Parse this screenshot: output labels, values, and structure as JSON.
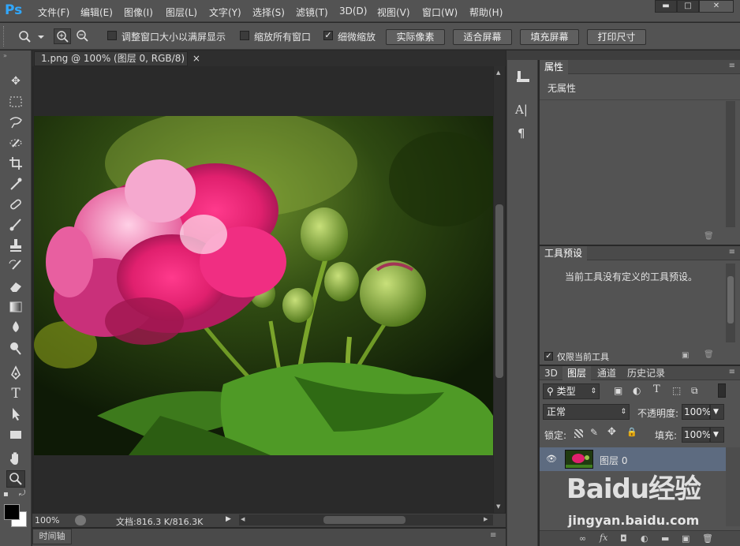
{
  "app": {
    "logo": "Ps"
  },
  "menu": [
    "文件(F)",
    "编辑(E)",
    "图像(I)",
    "图层(L)",
    "文字(Y)",
    "选择(S)",
    "滤镜(T)",
    "3D(D)",
    "视图(V)",
    "窗口(W)",
    "帮助(H)"
  ],
  "window_controls": {
    "minimize": "▬",
    "maximize": "□",
    "close": "✕"
  },
  "options": {
    "resize_windows": "调整窗口大小以满屏显示",
    "zoom_all": "缩放所有窗口",
    "scrubby_zoom": "细微缩放",
    "btn_actual": "实际像素",
    "btn_fit": "适合屏幕",
    "btn_fill": "填充屏幕",
    "btn_print": "打印尺寸",
    "resize_checked": false,
    "zoom_all_checked": false,
    "scrubby_checked": true
  },
  "document": {
    "tab_title": "1.png @ 100% (图层 0, RGB/8)",
    "tab_close": "×"
  },
  "status": {
    "zoom": "100%",
    "doc_size": "文档:816.3 K/816.3K"
  },
  "timeline": {
    "label": "时间轴"
  },
  "properties": {
    "title": "属性",
    "content": "无属性"
  },
  "tool_presets": {
    "title": "工具预设",
    "message": "当前工具没有定义的工具预设。",
    "current_only": "仅限当前工具",
    "current_only_checked": true
  },
  "layers": {
    "tabs": [
      "3D",
      "图层",
      "通道",
      "历史记录"
    ],
    "active_tab": "图层",
    "filter_kind": "类型",
    "blend_mode": "正常",
    "opacity_label": "不透明度:",
    "opacity": "100%",
    "lock_label": "锁定:",
    "fill_label": "填充:",
    "fill": "100%",
    "items": [
      {
        "name": "图层 0",
        "visible": true
      }
    ]
  },
  "watermark": {
    "brand": "Baidu经验",
    "url": "jingyan.baidu.com"
  },
  "colors": {
    "accent": "#31a8ff",
    "panel": "#535353",
    "canvas": "#282828",
    "selected_layer": "#5d6b80"
  }
}
